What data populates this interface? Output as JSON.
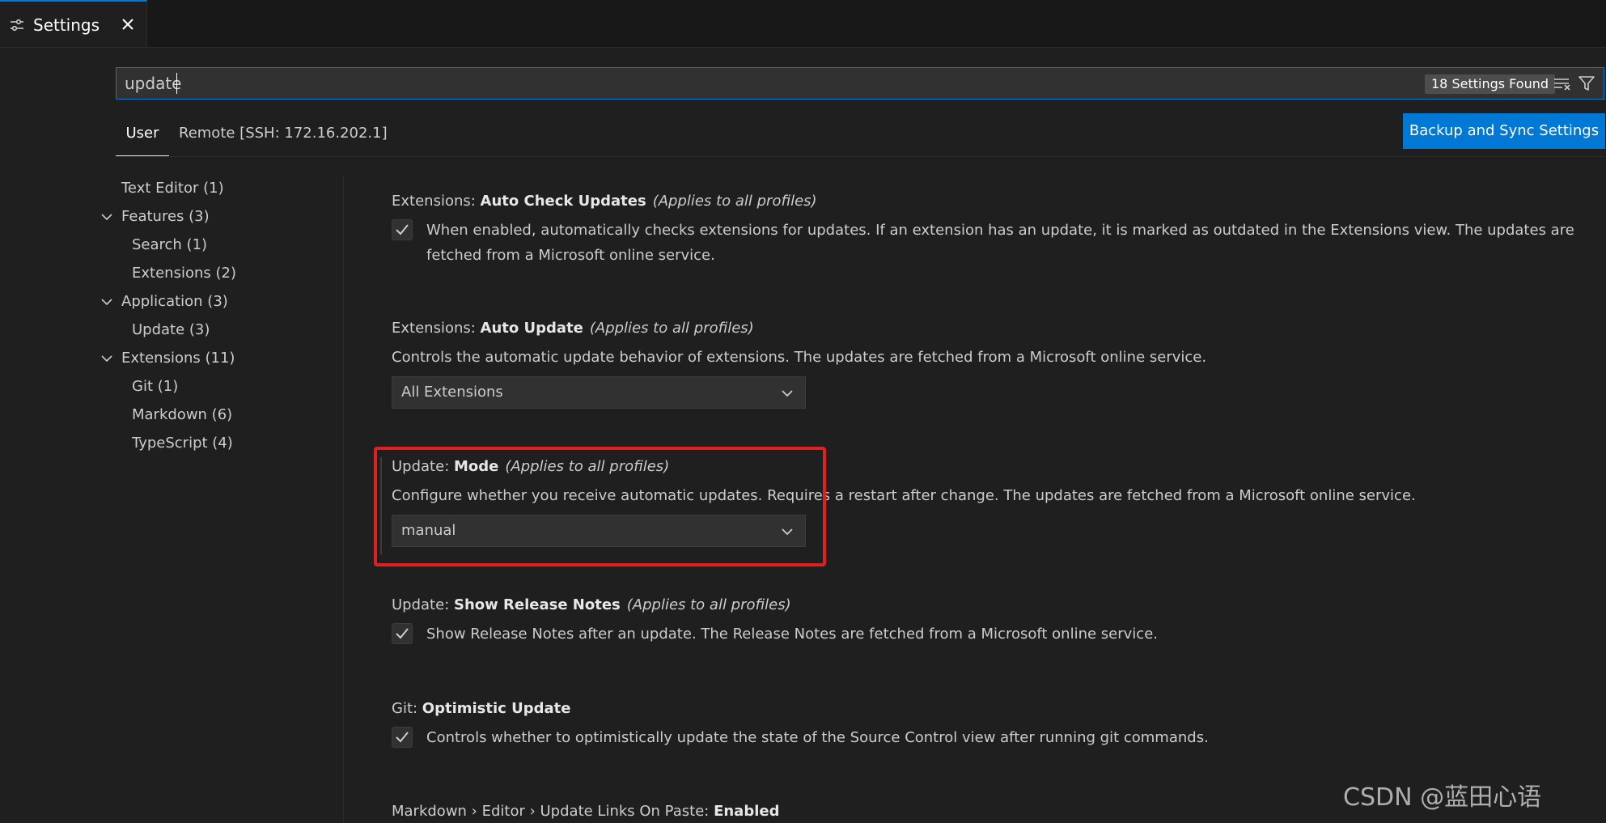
{
  "tab": {
    "label": "Settings",
    "icon": "settings-icon",
    "close_icon": "close-icon"
  },
  "search": {
    "value": "update",
    "result_count": "18 Settings Found",
    "clear_icon": "clear-filter-icon",
    "filter_icon": "filter-icon"
  },
  "scopes": {
    "user": "User",
    "remote": "Remote [SSH: 172.16.202.1]"
  },
  "sync_button": "Backup and Sync Settings",
  "toc": [
    {
      "label": "Text Editor (1)",
      "expanded": false
    },
    {
      "label": "Features (3)",
      "expanded": true
    },
    {
      "label": "Search (1)"
    },
    {
      "label": "Extensions (2)"
    },
    {
      "label": "Application (3)",
      "expanded": true
    },
    {
      "label": "Update (3)"
    },
    {
      "label": "Extensions (11)",
      "expanded": true
    },
    {
      "label": "Git (1)"
    },
    {
      "label": "Markdown (6)"
    },
    {
      "label": "TypeScript (4)"
    }
  ],
  "settings": [
    {
      "category": "Extensions: ",
      "key": "Auto Check Updates",
      "scope": "(Applies to all profiles)",
      "checked": true,
      "description": "When enabled, automatically checks extensions for updates. If an extension has an update, it is marked as outdated in the Extensions view. The updates are fetched from a Microsoft online service."
    },
    {
      "category": "Extensions: ",
      "key": "Auto Update",
      "scope": "(Applies to all profiles)",
      "description": "Controls the automatic update behavior of extensions. The updates are fetched from a Microsoft online service.",
      "value": "All Extensions"
    },
    {
      "category": "Update: ",
      "key": "Mode",
      "scope": "(Applies to all profiles)",
      "description": "Configure whether you receive automatic updates. Requires a restart after change. The updates are fetched from a Microsoft online service.",
      "value": "manual"
    },
    {
      "category": "Update: ",
      "key": "Show Release Notes",
      "scope": "(Applies to all profiles)",
      "checked": true,
      "description": "Show Release Notes after an update. The Release Notes are fetched from a Microsoft online service."
    },
    {
      "category": "Git: ",
      "key": "Optimistic Update",
      "checked": true,
      "description": "Controls whether to optimistically update the state of the Source Control view after running git commands."
    },
    {
      "category": "Markdown › Editor › Update Links On Paste: ",
      "key": "Enabled"
    }
  ],
  "watermark": "CSDN @蓝田心语",
  "colors": {
    "accent": "#0078d4",
    "highlight": "#e02020",
    "background": "#1f1f1f"
  }
}
